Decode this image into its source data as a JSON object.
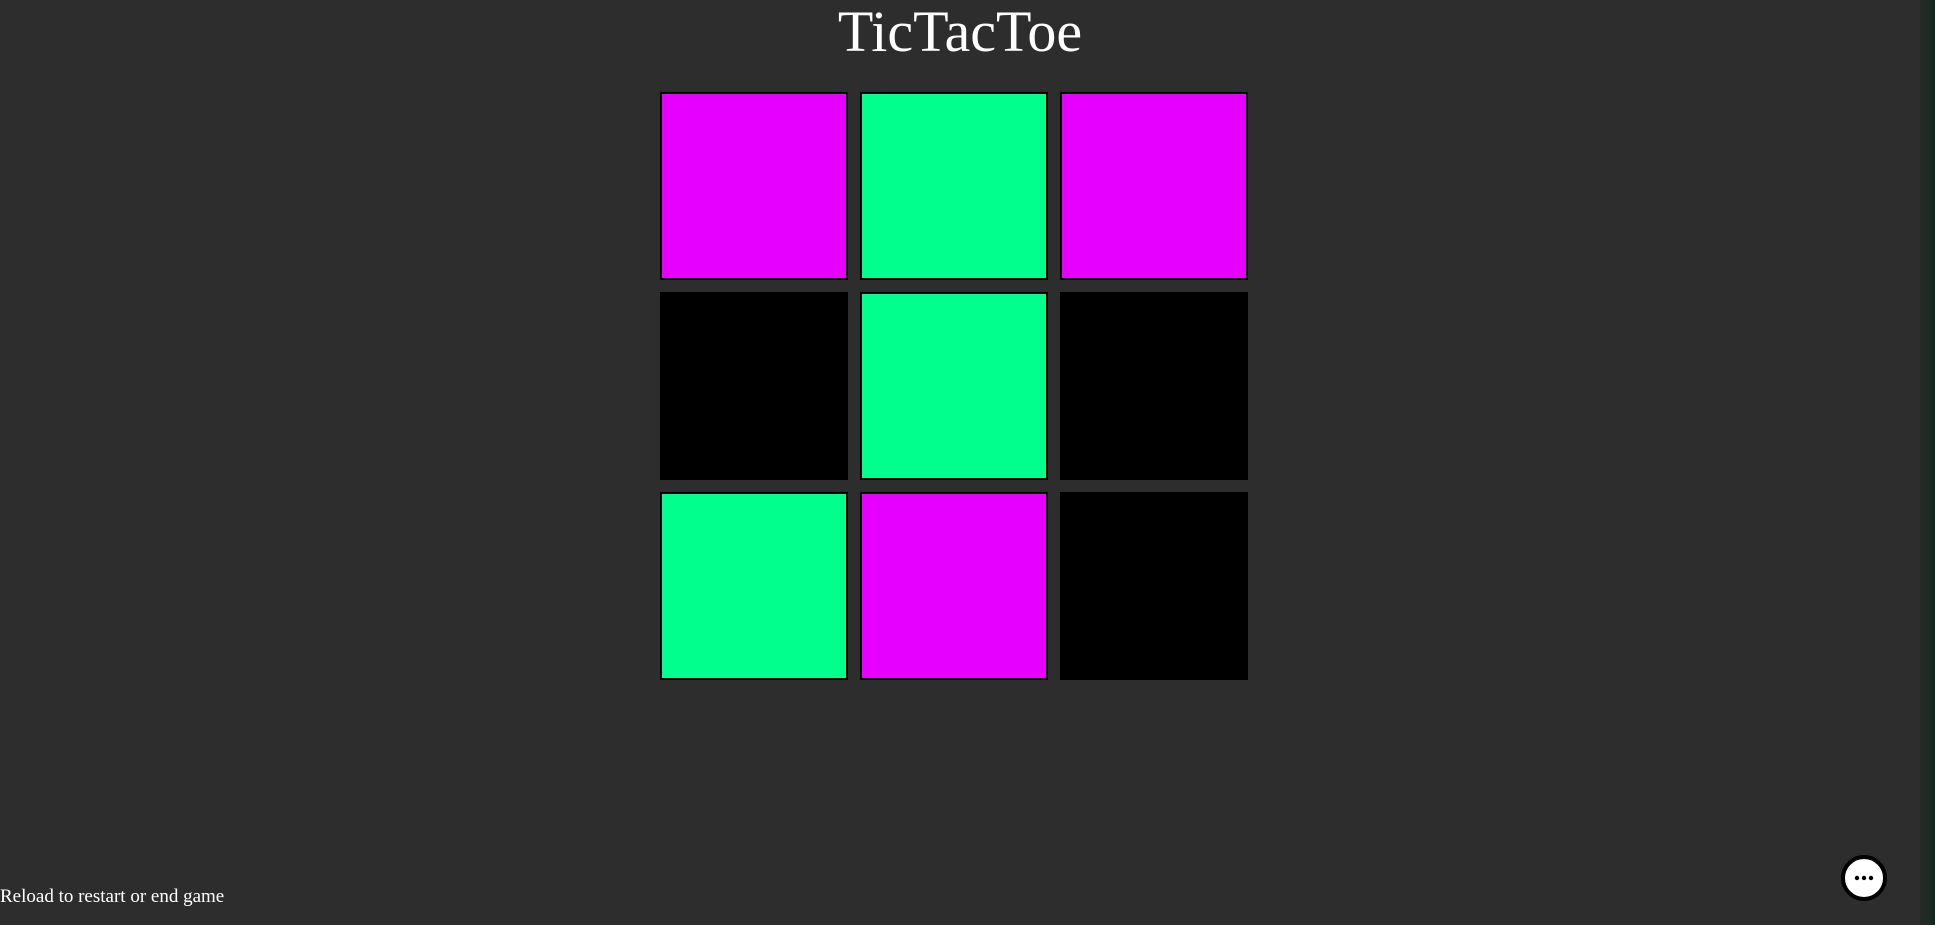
{
  "title": "TicTacToe",
  "footer_text": "Reload to restart or end game",
  "colors": {
    "background": "#2d2d2d",
    "player_one": "#e600ff",
    "player_two": "#00ff8c",
    "empty": "#000000"
  },
  "board": [
    [
      "player_one",
      "player_two",
      "player_one"
    ],
    [
      "empty",
      "player_two",
      "empty"
    ],
    [
      "player_two",
      "player_one",
      "empty"
    ]
  ],
  "chat_button": {
    "icon": "ellipsis-icon"
  }
}
